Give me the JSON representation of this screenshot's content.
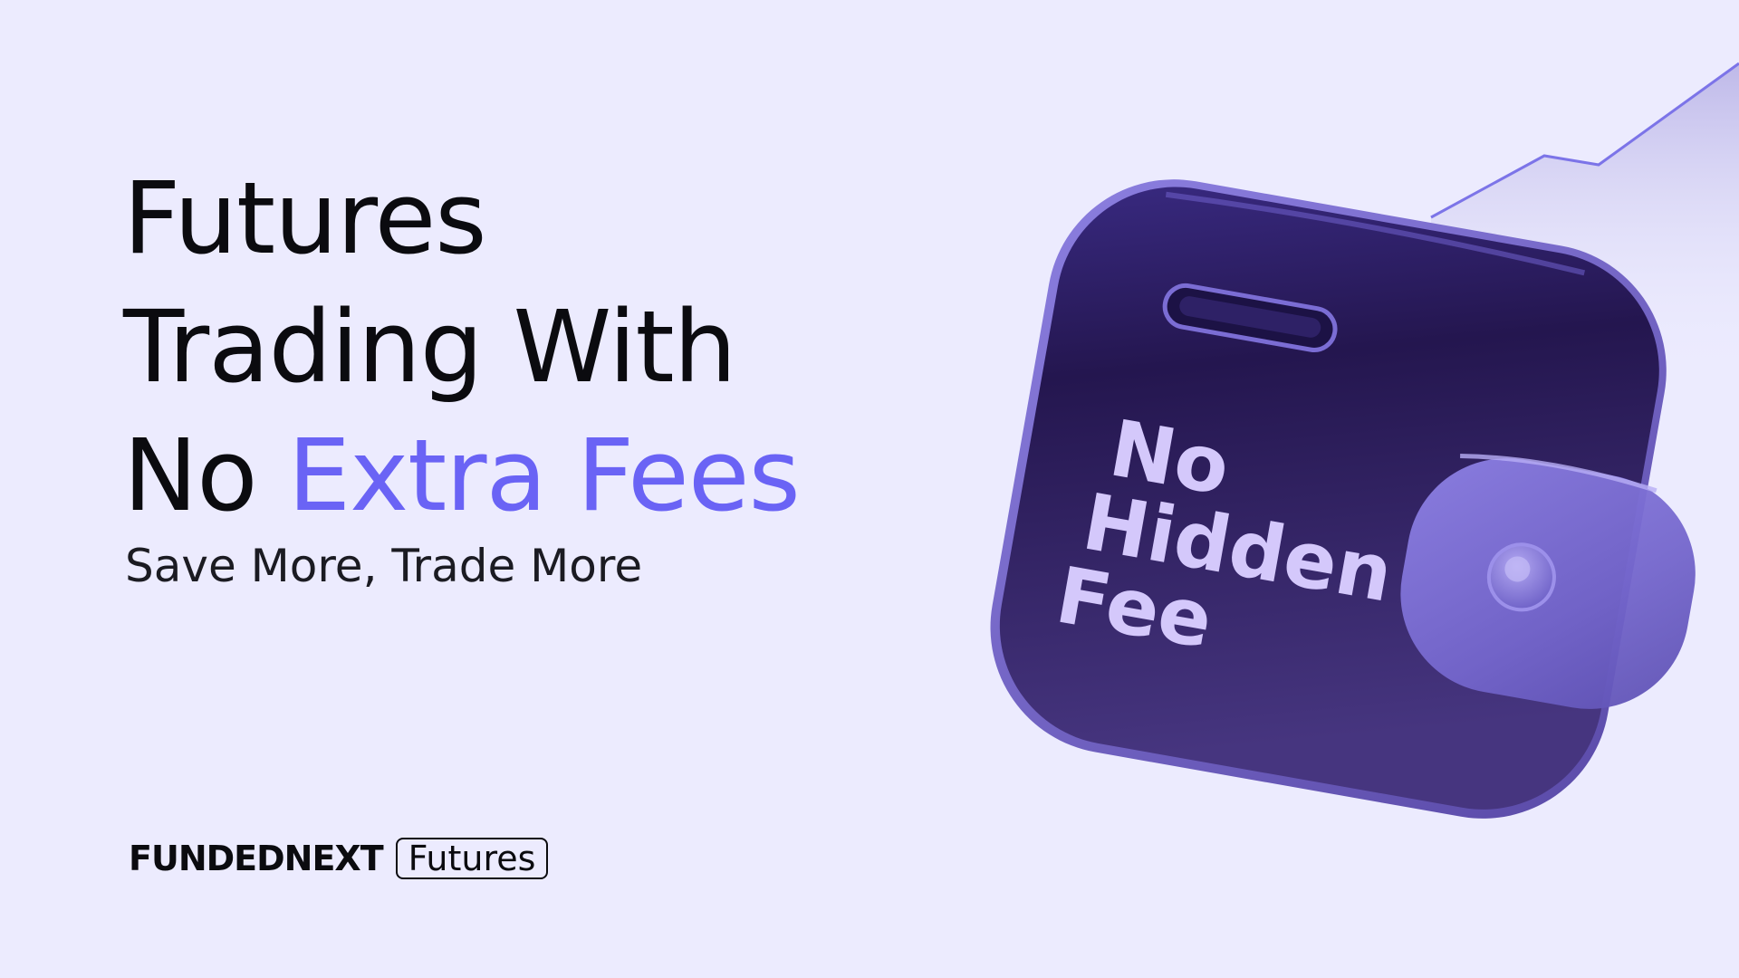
{
  "headline": {
    "line1": "Futures",
    "line2": "Trading With",
    "line3_plain": "No ",
    "line3_accent": "Extra Fees"
  },
  "subtitle": "Save More, Trade More",
  "wallet_text": {
    "line1": "No",
    "line2": "Hidden",
    "line3": "Fee"
  },
  "brand": {
    "wordmark": "FUNDEDNEXT",
    "product_tag": "Futures"
  },
  "colors": {
    "background": "#ecebfe",
    "accent": "#6a63f5",
    "wallet_dark": "#2a1d66",
    "wallet_light": "#7f72d6",
    "wallet_text": "#d4c8fb"
  },
  "icons": [
    "wallet-illustration",
    "trend-line-chart"
  ]
}
